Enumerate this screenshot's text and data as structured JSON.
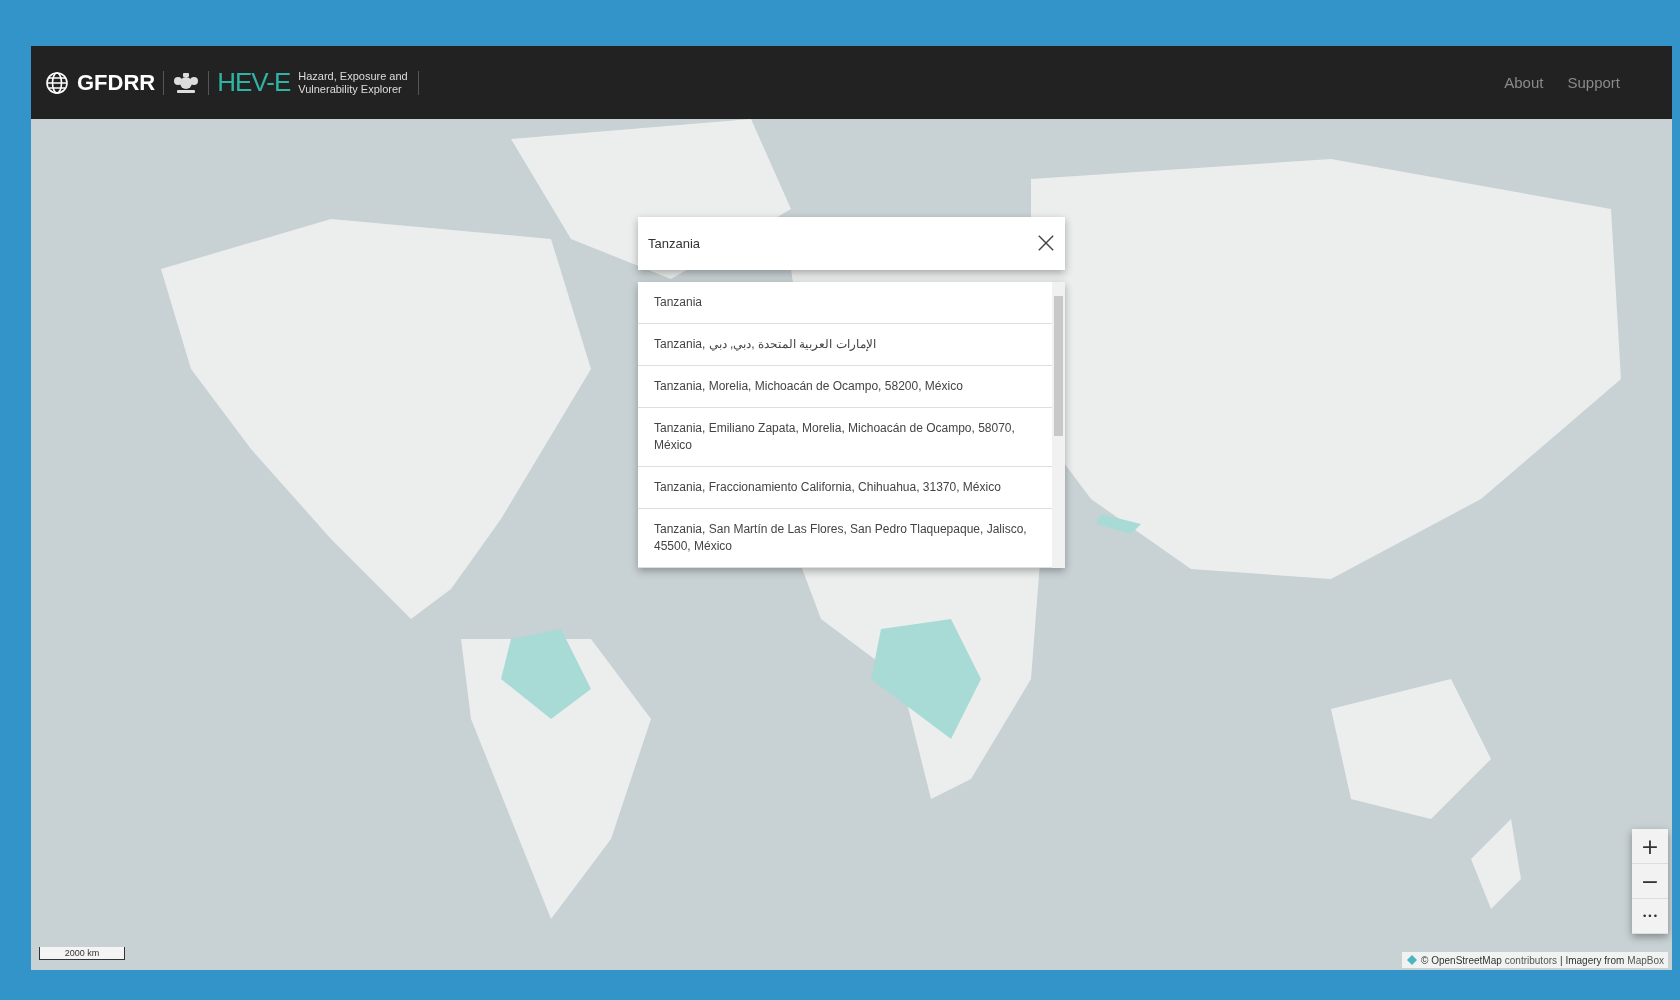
{
  "header": {
    "brand": "GFDRR",
    "app_name": "HEV-E",
    "app_subtitle": "Hazard, Exposure and Vulnerability Explorer",
    "nav": [
      {
        "label": "About"
      },
      {
        "label": "Support"
      }
    ]
  },
  "map": {
    "scale_label": "2000 km",
    "attribution": {
      "prefix": "© OpenStreetMap",
      "link1": "contributors",
      "sep": "| Imagery from",
      "link2": "MapBox"
    },
    "zoom_controls": [
      {
        "kind": "zoom-in",
        "label": "+"
      },
      {
        "kind": "zoom-out",
        "label": "−"
      },
      {
        "kind": "more",
        "label": "•••"
      }
    ]
  },
  "search": {
    "value": "Tanzania",
    "results": [
      {
        "label": "Tanzania"
      },
      {
        "label": "Tanzania, الإمارات العربية المتحدة ,دبي, دبي"
      },
      {
        "label": "Tanzania, Morelia, Michoacán de Ocampo, 58200, México"
      },
      {
        "label": "Tanzania, Emiliano Zapata, Morelia, Michoacán de Ocampo, 58070, México"
      },
      {
        "label": "Tanzania, Fraccionamiento California, Chihuahua, 31370, México"
      },
      {
        "label": "Tanzania, San Martín de Las Flores, San Pedro Tlaquepaque, Jalisco, 45500, México"
      }
    ]
  }
}
